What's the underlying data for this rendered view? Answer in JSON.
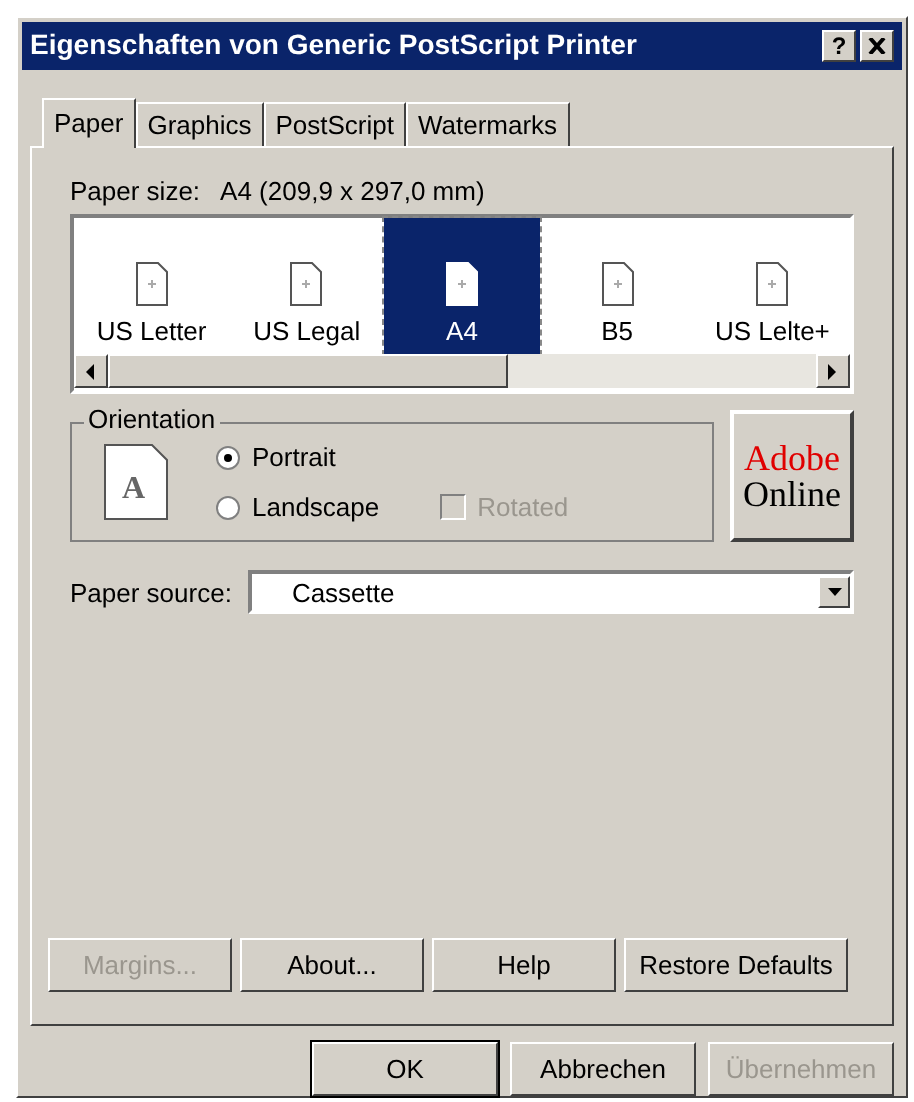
{
  "window": {
    "title": "Eigenschaften von Generic PostScript Printer",
    "help_button": "?"
  },
  "tabs": [
    {
      "label": "Paper",
      "selected": true
    },
    {
      "label": "Graphics",
      "selected": false
    },
    {
      "label": "PostScript",
      "selected": false
    },
    {
      "label": "Watermarks",
      "selected": false
    }
  ],
  "paper_size": {
    "label": "Paper size:",
    "value": "A4 (209,9 x 297,0 mm)"
  },
  "papers": [
    {
      "label": "US Letter",
      "selected": false
    },
    {
      "label": "US Legal",
      "selected": false
    },
    {
      "label": "A4",
      "selected": true
    },
    {
      "label": "B5",
      "selected": false
    },
    {
      "label": "US Lelte+",
      "selected": false
    }
  ],
  "orientation": {
    "title": "Orientation",
    "page_letter": "A",
    "options": [
      {
        "label": "Portrait",
        "selected": true
      },
      {
        "label": "Landscape",
        "selected": false
      }
    ],
    "rotated": {
      "label": "Rotated",
      "checked": false,
      "disabled": true
    }
  },
  "adobe_online": {
    "line_1": "Adobe",
    "line_2": "Online"
  },
  "paper_source": {
    "label": "Paper source:",
    "value": "Cassette"
  },
  "panel_buttons": [
    {
      "label": "Margins...",
      "disabled": true
    },
    {
      "label": "About...",
      "disabled": false
    },
    {
      "label": "Help",
      "disabled": false
    },
    {
      "label": "Restore Defaults",
      "disabled": false
    }
  ],
  "dialog_buttons": [
    {
      "label": "OK",
      "disabled": false
    },
    {
      "label": "Abbrechen",
      "disabled": false
    },
    {
      "label": "Übernehmen",
      "disabled": true
    }
  ]
}
